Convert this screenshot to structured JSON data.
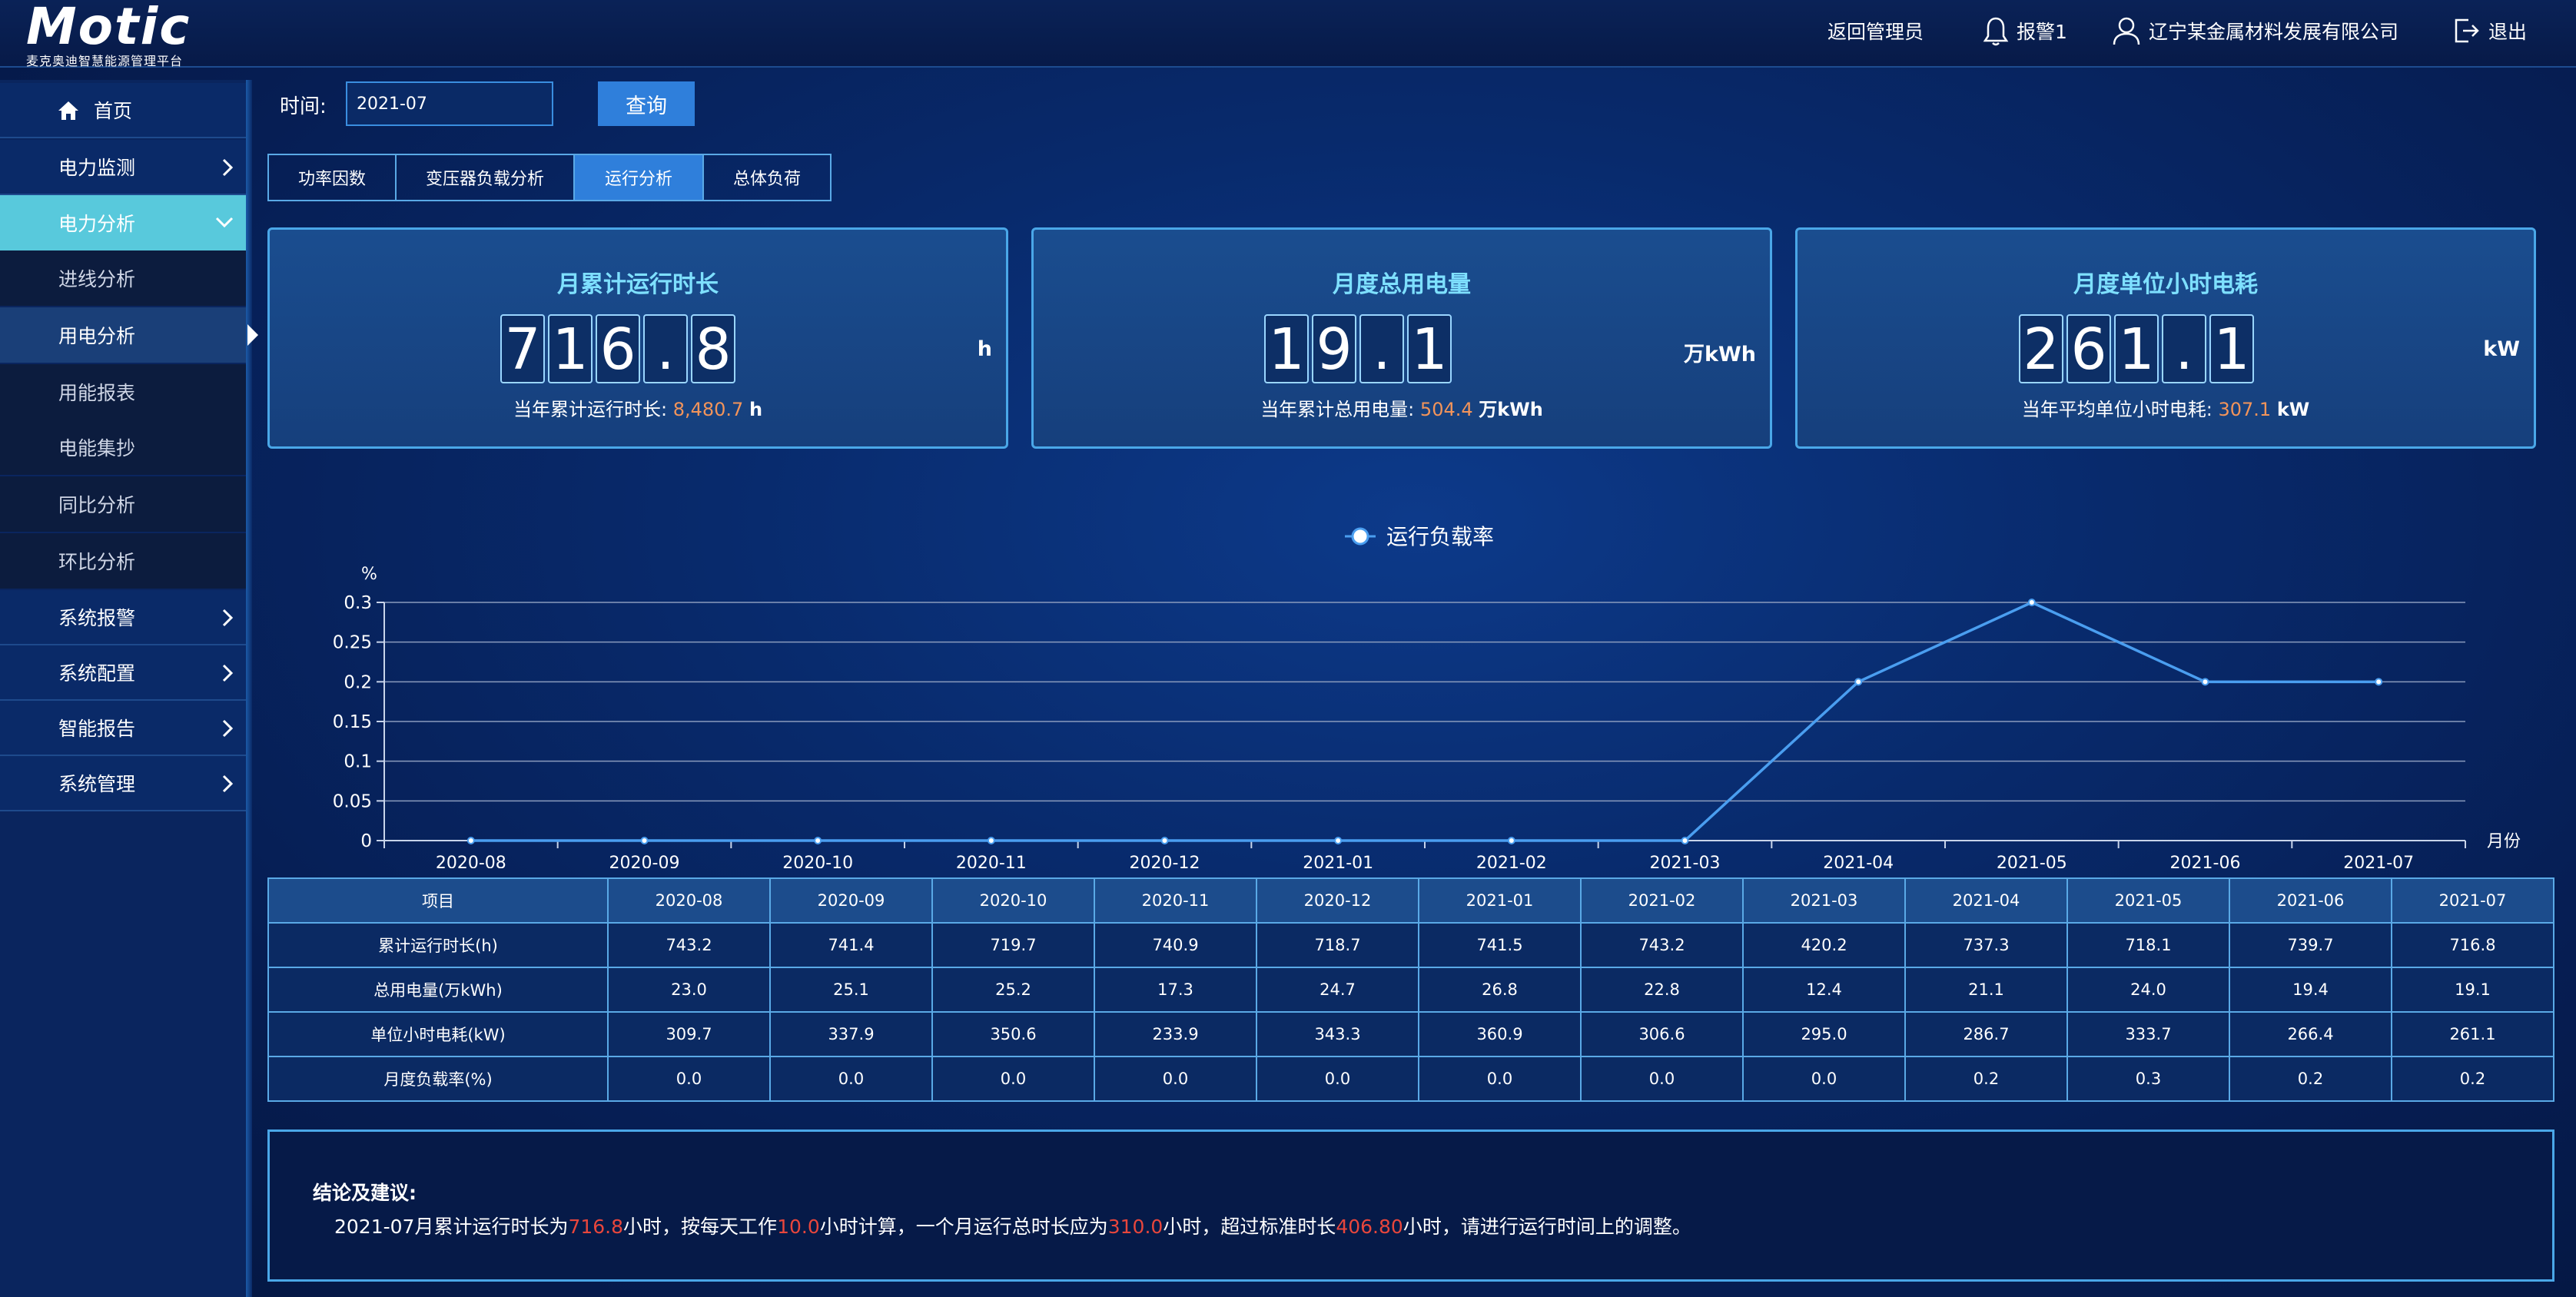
{
  "header": {
    "logo": "Motic",
    "logo_subtitle": "麦克奥迪智慧能源管理平台",
    "back_admin": "返回管理员",
    "alarm": "报警1",
    "company": "辽宁某金属材料发展有限公司",
    "logout": "退出"
  },
  "sidebar": {
    "home": "首页",
    "power_monitor": "电力监测",
    "power_analysis": "电力分析",
    "sub": [
      "进线分析",
      "用电分析",
      "用能报表",
      "电能集抄",
      "同比分析",
      "环比分析"
    ],
    "system_alarm": "系统报警",
    "system_config": "系统配置",
    "smart_report": "智能报告",
    "system_manage": "系统管理"
  },
  "filter": {
    "time_label": "时间:",
    "time_value": "2021-07",
    "query": "查询"
  },
  "tabs": [
    "功率因数",
    "变压器负载分析",
    "运行分析",
    "总体负荷"
  ],
  "cards": [
    {
      "title": "月累计运行时长",
      "digits": [
        "7",
        "1",
        "6",
        ".",
        "8"
      ],
      "unit": "h",
      "sub_label": "当年累计运行时长:",
      "sub_value": "8,480.7",
      "sub_unit": "h"
    },
    {
      "title": "月度总用电量",
      "digits": [
        "1",
        "9",
        ".",
        "1"
      ],
      "unit": "万kWh",
      "sub_label": "当年累计总用电量:",
      "sub_value": "504.4",
      "sub_unit": "万kWh"
    },
    {
      "title": "月度单位小时电耗",
      "digits": [
        "2",
        "6",
        "1",
        ".",
        "1"
      ],
      "unit": "kW",
      "sub_label": "当年平均单位小时电耗:",
      "sub_value": "307.1",
      "sub_unit": "kW"
    }
  ],
  "chart_data": {
    "type": "line",
    "title": "",
    "ylabel": "%",
    "xlabel": "月份",
    "ylim": [
      0,
      0.3
    ],
    "yticks": [
      "0",
      "0.05",
      "0.1",
      "0.15",
      "0.2",
      "0.25",
      "0.3"
    ],
    "grid": true,
    "legend": "top-center",
    "series": [
      {
        "name": "运行负载率",
        "x": [
          "2020-08",
          "2020-09",
          "2020-10",
          "2020-11",
          "2020-12",
          "2021-01",
          "2021-02",
          "2021-03",
          "2021-04",
          "2021-05",
          "2021-06",
          "2021-07"
        ],
        "values": [
          0,
          0,
          0,
          0,
          0,
          0,
          0,
          0,
          0.2,
          0.3,
          0.2,
          0.2
        ],
        "color": "#4a9ef0"
      }
    ]
  },
  "table": {
    "headers": [
      "项目",
      "2020-08",
      "2020-09",
      "2020-10",
      "2020-11",
      "2020-12",
      "2021-01",
      "2021-02",
      "2021-03",
      "2021-04",
      "2021-05",
      "2021-06",
      "2021-07"
    ],
    "rows": [
      [
        "累计运行时长(h)",
        "743.2",
        "741.4",
        "719.7",
        "740.9",
        "718.7",
        "741.5",
        "743.2",
        "420.2",
        "737.3",
        "718.1",
        "739.7",
        "716.8"
      ],
      [
        "总用电量(万kWh)",
        "23.0",
        "25.1",
        "25.2",
        "17.3",
        "24.7",
        "26.8",
        "22.8",
        "12.4",
        "21.1",
        "24.0",
        "19.4",
        "19.1"
      ],
      [
        "单位小时电耗(kW)",
        "309.7",
        "337.9",
        "350.6",
        "233.9",
        "343.3",
        "360.9",
        "306.6",
        "295.0",
        "286.7",
        "333.7",
        "266.4",
        "261.1"
      ],
      [
        "月度负载率(%)",
        "0.0",
        "0.0",
        "0.0",
        "0.0",
        "0.0",
        "0.0",
        "0.0",
        "0.0",
        "0.2",
        "0.3",
        "0.2",
        "0.2"
      ]
    ]
  },
  "conclusion": {
    "title": "结论及建议:",
    "p1": "2021-07月累计运行时长为",
    "v1": "716.8",
    "p2": "小时，按每天工作",
    "v2": "10.0",
    "p3": "小时计算，一个月运行总时长应为",
    "v3": "310.0",
    "p4": "小时，超过标准时长",
    "v4": "406.80",
    "p5": "小时，请进行运行时间上的调整。"
  },
  "colors": {
    "accent": "#2f7fdb",
    "active_nav": "#58c9dc",
    "card_title": "#7ee0ff",
    "highlight_value": "#f2945a",
    "conclusion_value": "#e8463c"
  }
}
